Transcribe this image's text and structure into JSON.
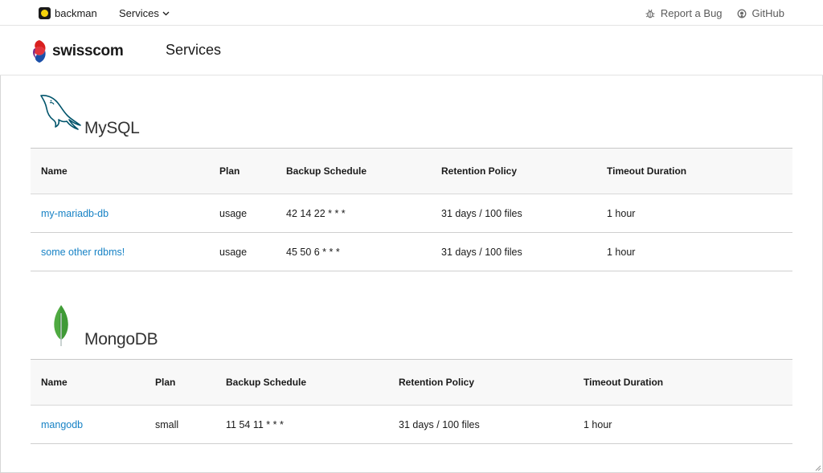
{
  "topnav": {
    "brand": "backman",
    "services_menu": "Services",
    "report_bug": "Report a Bug",
    "github": "GitHub"
  },
  "header": {
    "company": "swisscom",
    "page_title": "Services"
  },
  "sections": [
    {
      "db": "MySQL",
      "columns": [
        "Name",
        "Plan",
        "Backup Schedule",
        "Retention Policy",
        "Timeout Duration"
      ],
      "rows": [
        {
          "name": "my-mariadb-db",
          "plan": "usage",
          "schedule": "42 14 22 * * *",
          "retention": "31 days / 100 files",
          "timeout": "1 hour"
        },
        {
          "name": "some other rdbms!",
          "plan": "usage",
          "schedule": "45 50 6 * * *",
          "retention": "31 days / 100 files",
          "timeout": "1 hour"
        }
      ]
    },
    {
      "db": "MongoDB",
      "columns": [
        "Name",
        "Plan",
        "Backup Schedule",
        "Retention Policy",
        "Timeout Duration"
      ],
      "rows": [
        {
          "name": "mangodb",
          "plan": "small",
          "schedule": "11 54 11 * * *",
          "retention": "31 days / 100 files",
          "timeout": "1 hour"
        }
      ]
    }
  ],
  "colors": {
    "link": "#1782c5",
    "mysql_logo": "#00546b",
    "mongo_leaf": "#4faa41",
    "swisscom_red": "#d9201f",
    "swisscom_blue": "#1b4fa8"
  }
}
